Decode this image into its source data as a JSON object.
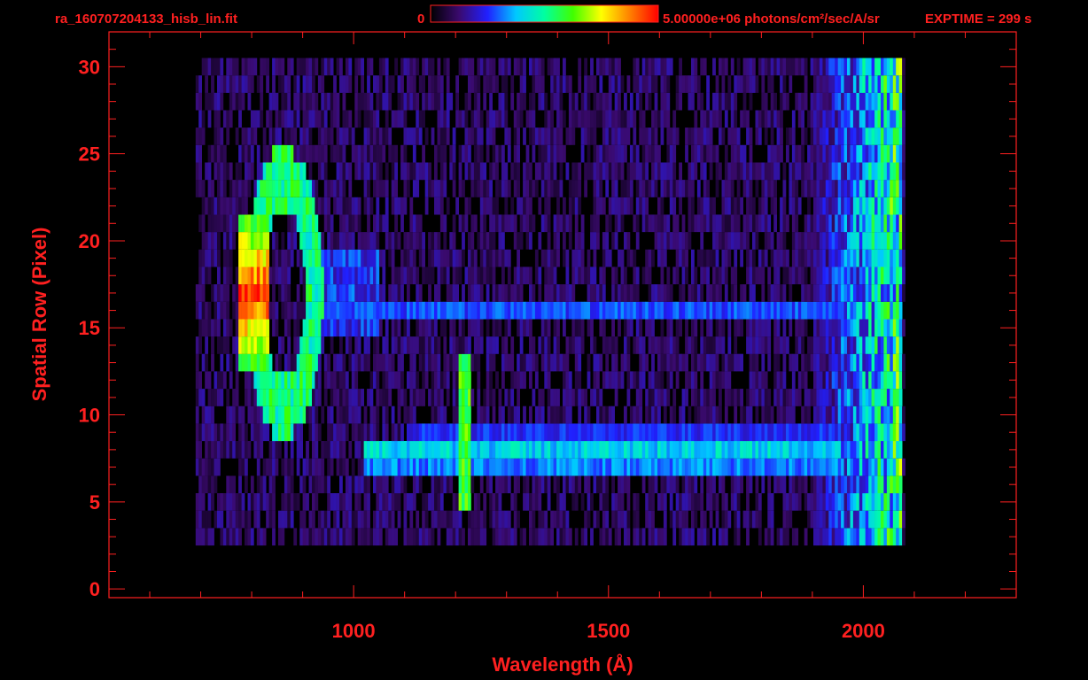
{
  "header": {
    "filename": "ra_160707204133_hisb_lin.fit",
    "colorbar_min": "0",
    "colorbar_max_label": "5.00000e+06 photons/cm²/sec/A/sr",
    "exptime": "EXPTIME = 299 s"
  },
  "colors": {
    "frame": "#ff2020",
    "background": "#000000",
    "colormap": [
      "#000000",
      "#3a0a6e",
      "#2020ff",
      "#00c8ff",
      "#00ffa0",
      "#40ff00",
      "#ffff00",
      "#ff8000",
      "#ff0000"
    ]
  },
  "chart_data": {
    "type": "heatmap",
    "xlabel": "Wavelength (Å)",
    "ylabel": "Spatial Row (Pixel)",
    "xlim": [
      520,
      2300
    ],
    "ylim": [
      -0.5,
      32
    ],
    "xticks": [
      1000,
      1500,
      2000
    ],
    "yticks": [
      0,
      5,
      10,
      15,
      20,
      25,
      30
    ],
    "x_minor_step": 100,
    "y_minor_step": 1,
    "data_x_range": [
      690,
      2080
    ],
    "data_rows": [
      3,
      30
    ],
    "colorbar_range": [
      0,
      5000000
    ],
    "features": [
      {
        "kind": "ring",
        "center_x": 860,
        "center_y": 17,
        "radius_x": 60,
        "radius_y": 6.5,
        "level": 0.55
      },
      {
        "kind": "bright_arc",
        "x_range": [
          770,
          830
        ],
        "row_range": [
          13,
          21
        ],
        "level": 1.0
      },
      {
        "kind": "band",
        "row": 8,
        "x_range": [
          1020,
          1950
        ],
        "level": 0.4
      },
      {
        "kind": "band",
        "row": 7,
        "x_range": [
          1020,
          1950
        ],
        "level": 0.32
      },
      {
        "kind": "band",
        "row": 9,
        "x_range": [
          1100,
          1950
        ],
        "level": 0.25
      },
      {
        "kind": "band",
        "row": 16,
        "x_range": [
          940,
          1950
        ],
        "level": 0.28
      },
      {
        "kind": "vertical_line",
        "x": 1216,
        "row_range": [
          5,
          13
        ],
        "level": 0.62
      },
      {
        "kind": "edge_columns",
        "x_range": [
          1900,
          2075
        ],
        "level": 0.5
      }
    ]
  }
}
